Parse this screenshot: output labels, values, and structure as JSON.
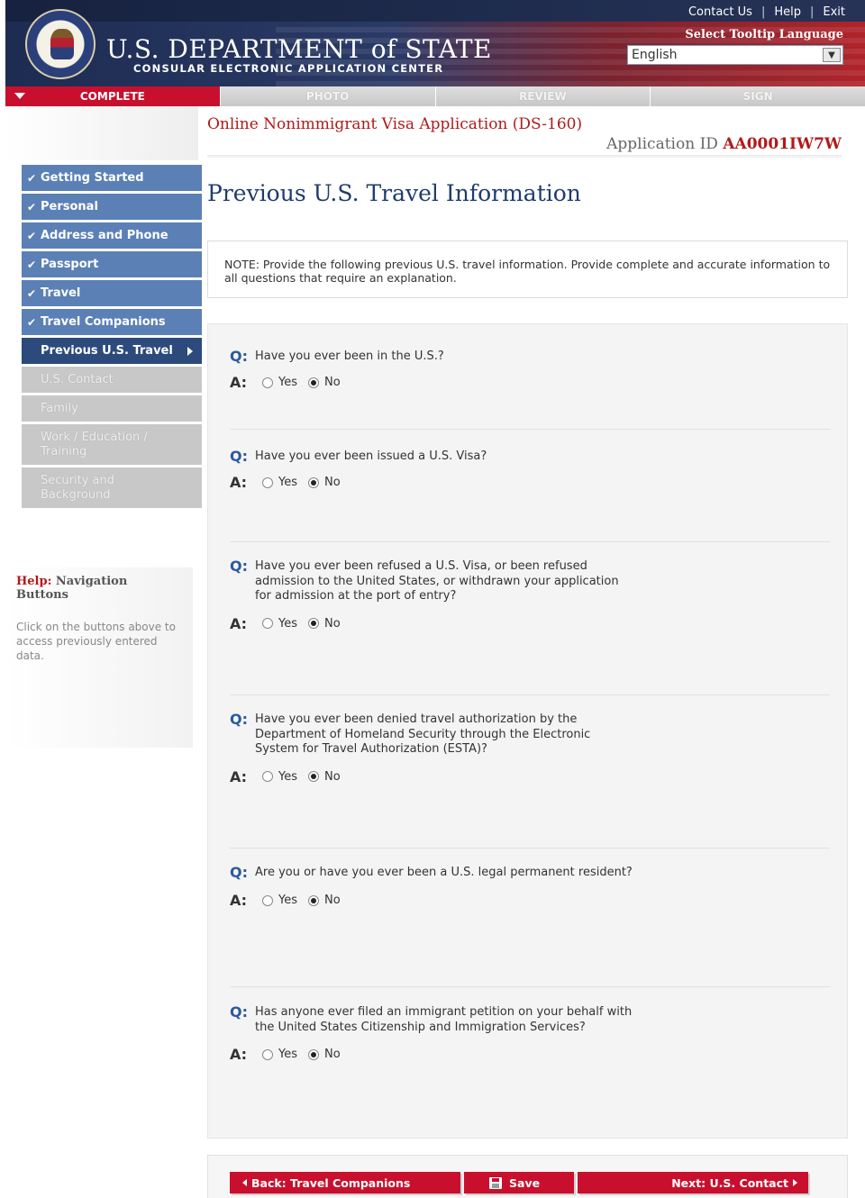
{
  "header": {
    "department": "U.S. DEPARTMENT of STATE",
    "subtitle": "CONSULAR ELECTRONIC APPLICATION CENTER",
    "links": [
      "Contact Us",
      "Help",
      "Exit"
    ],
    "tooltip_label": "Select Tooltip Language",
    "language_value": "English"
  },
  "progress": {
    "steps": [
      "COMPLETE",
      "PHOTO",
      "REVIEW",
      "SIGN"
    ],
    "active": "COMPLETE"
  },
  "app": {
    "title": "Online Nonimmigrant Visa Application (DS-160)",
    "id_label": "Application ID",
    "id_value": "AA0001IW7W"
  },
  "sidebar": {
    "items": [
      {
        "label": "Getting Started",
        "state": "done"
      },
      {
        "label": "Personal",
        "state": "done"
      },
      {
        "label": "Address and Phone",
        "state": "done"
      },
      {
        "label": "Passport",
        "state": "done"
      },
      {
        "label": "Travel",
        "state": "done"
      },
      {
        "label": "Travel Companions",
        "state": "done"
      },
      {
        "label": "Previous U.S. Travel",
        "state": "current"
      },
      {
        "label": "U.S. Contact",
        "state": "disabled"
      },
      {
        "label": "Family",
        "state": "disabled"
      },
      {
        "label": "Work / Education / Training",
        "state": "disabled"
      },
      {
        "label": "Security and Background",
        "state": "disabled"
      }
    ]
  },
  "help": {
    "prefix": "Help:",
    "title": "Navigation Buttons",
    "text": "Click on the buttons above to access previously entered data."
  },
  "page": {
    "title": "Previous U.S. Travel Information",
    "note": "NOTE: Provide the following previous U.S. travel information. Provide complete and accurate information to all questions that require an explanation."
  },
  "questions": [
    {
      "q": "Have you ever been in the U.S.?",
      "answer": "No"
    },
    {
      "q": "Have you ever been issued a U.S. Visa?",
      "answer": "No"
    },
    {
      "q": "Have you ever been refused a U.S. Visa, or been refused admission to the United States, or withdrawn your application for admission at the port of entry?",
      "answer": "No"
    },
    {
      "q": "Have you ever been denied travel authorization by the Department of Homeland Security through the Electronic System for Travel Authorization (ESTA)?",
      "answer": "No"
    },
    {
      "q": "Are you or have you ever been a U.S. legal permanent resident?",
      "answer": "No"
    },
    {
      "q": "Has anyone ever filed an immigrant petition on your behalf with the United States Citizenship and Immigration Services?",
      "answer": "No"
    }
  ],
  "labels": {
    "q": "Q:",
    "a": "A:",
    "yes": "Yes",
    "no": "No"
  },
  "footer": {
    "back": "Back: Travel Companions",
    "save": "Save",
    "next": "Next: U.S. Contact"
  }
}
